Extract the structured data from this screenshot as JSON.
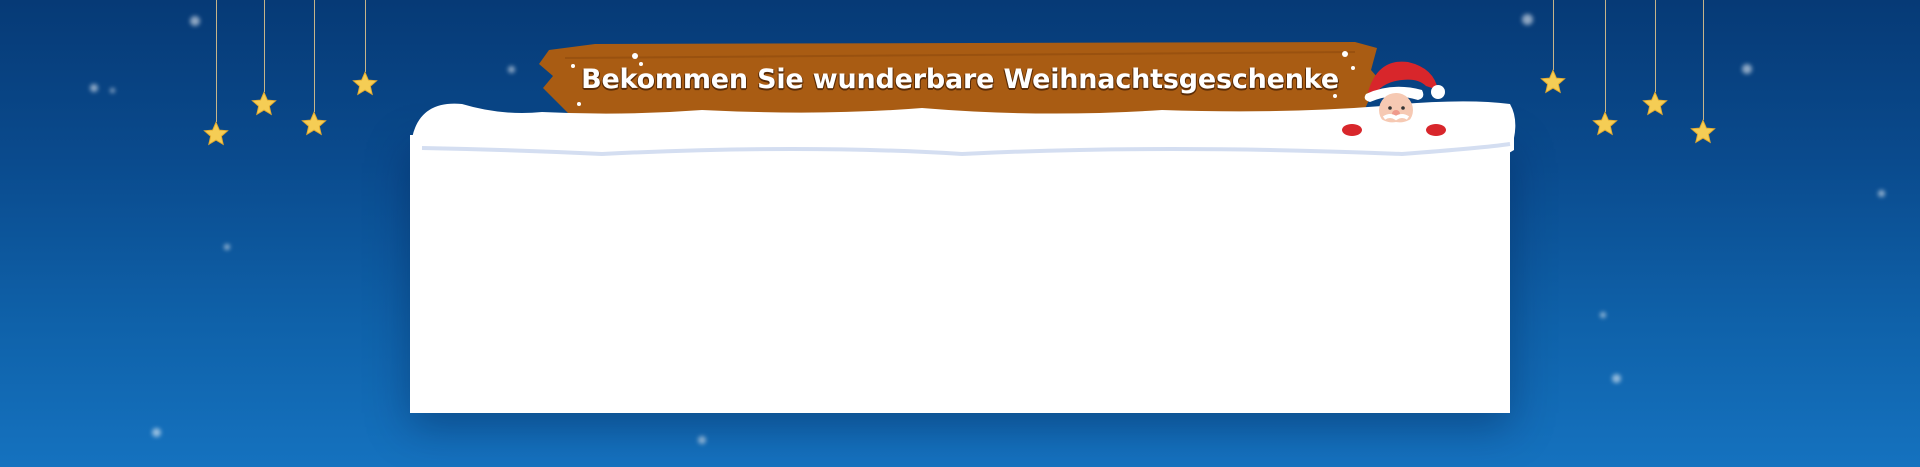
{
  "banner": {
    "title": "Bekommen Sie wunderbare Weihnachtsgeschenke"
  },
  "colors": {
    "background_top": "#063a76",
    "background_bottom": "#1572bf",
    "plank": "#a95c13",
    "star": "#f5cd55",
    "panel": "#ffffff"
  },
  "icons": {
    "hanging_star": "star-icon",
    "santa": "santa-icon"
  }
}
